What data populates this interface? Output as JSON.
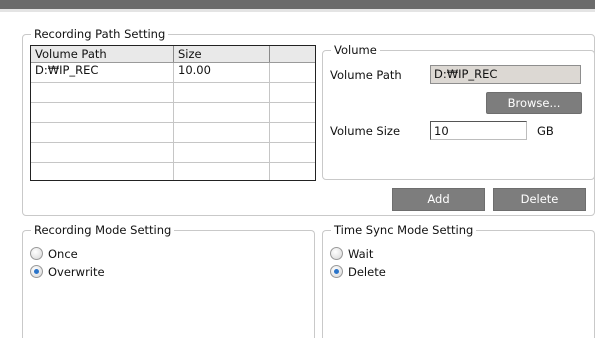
{
  "recording_path": {
    "title": "Recording Path Setting",
    "table": {
      "columns": [
        "Volume Path",
        "Size",
        ""
      ],
      "rows": [
        [
          "D:₩IP_REC",
          "10.00",
          ""
        ],
        [
          "",
          "",
          ""
        ],
        [
          "",
          "",
          ""
        ],
        [
          "",
          "",
          ""
        ],
        [
          "",
          "",
          ""
        ],
        [
          "",
          "",
          ""
        ]
      ]
    },
    "volume": {
      "title": "Volume",
      "path_label": "Volume Path",
      "path_value": "D:₩IP_REC",
      "browse_label": "Browse...",
      "size_label": "Volume Size",
      "size_value": "10",
      "size_unit": "GB"
    },
    "add_label": "Add",
    "delete_label": "Delete"
  },
  "recording_mode": {
    "title": "Recording Mode Setting",
    "options": [
      {
        "label": "Once",
        "selected": false
      },
      {
        "label": "Overwrite",
        "selected": true
      }
    ]
  },
  "time_sync": {
    "title": "Time Sync Mode Setting",
    "options": [
      {
        "label": "Wait",
        "selected": false
      },
      {
        "label": "Delete",
        "selected": true
      }
    ]
  },
  "colors": {
    "accent": "#2b74c9",
    "button_bg": "#7d7d7d",
    "readonly_bg": "#dcd8d3",
    "topbar": "#6b6b6b"
  }
}
